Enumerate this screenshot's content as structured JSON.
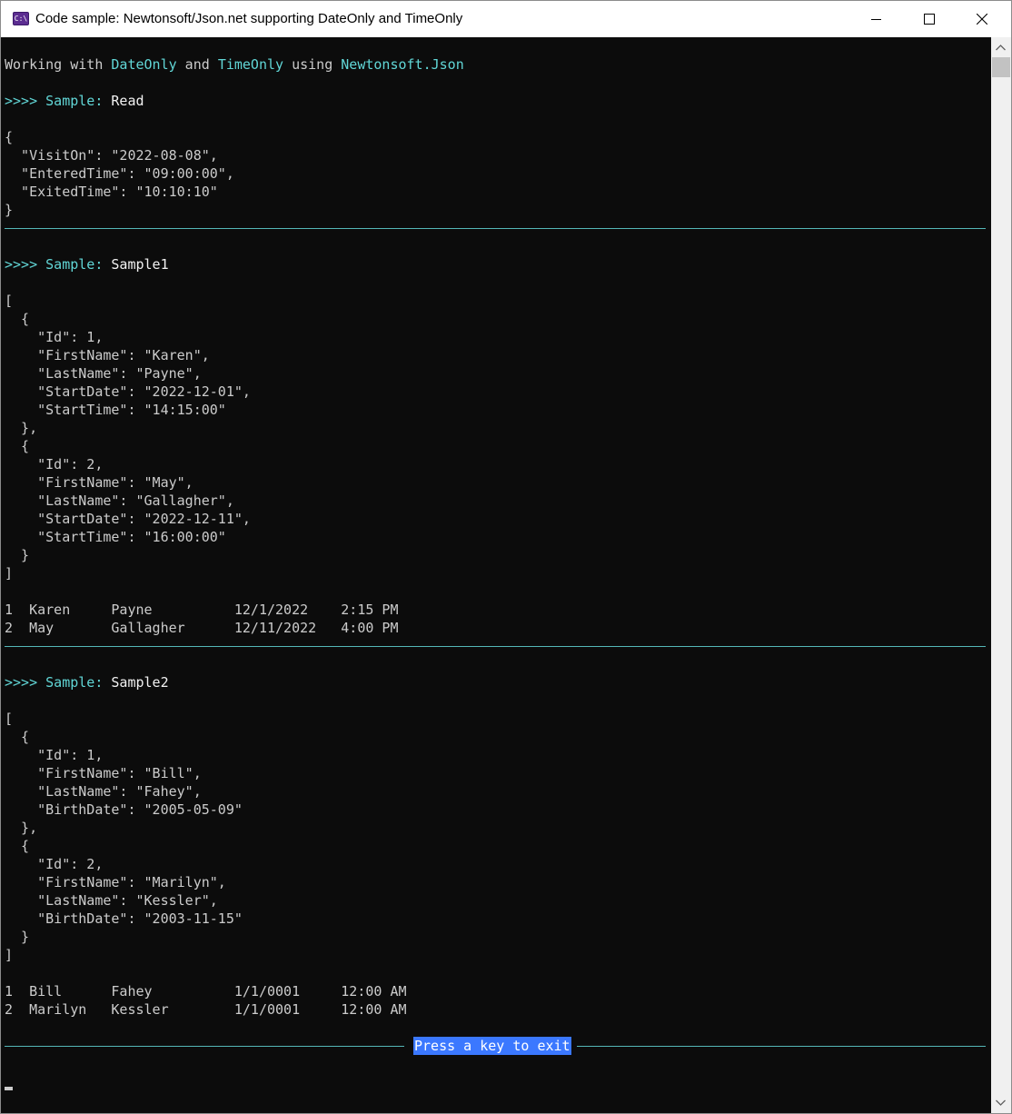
{
  "window": {
    "title": "Code sample: Newtonsoft/Json.net supporting DateOnly and TimeOnly",
    "icon": "console-app-icon",
    "icon_text": "C:\\"
  },
  "colors": {
    "background": "#0c0c0c",
    "text": "#cccccc",
    "accent": "#61d6d6",
    "highlight": "#3b78ff"
  },
  "header": {
    "p1": "Working with ",
    "dateonly": "DateOnly",
    "p2": " and ",
    "timeonly": "TimeOnly",
    "p3": " using ",
    "lib": "Newtonsoft.Json"
  },
  "prompt_marker": ">>>> Sample: ",
  "samples": {
    "read": {
      "name": "Read",
      "lines": [
        "{",
        "  \"VisitOn\": \"2022-08-08\",",
        "  \"EnteredTime\": \"09:00:00\",",
        "  \"ExitedTime\": \"10:10:10\"",
        "}"
      ]
    },
    "sample1": {
      "name": "Sample1",
      "lines": [
        "[",
        "  {",
        "    \"Id\": 1,",
        "    \"FirstName\": \"Karen\",",
        "    \"LastName\": \"Payne\",",
        "    \"StartDate\": \"2022-12-01\",",
        "    \"StartTime\": \"14:15:00\"",
        "  },",
        "  {",
        "    \"Id\": 2,",
        "    \"FirstName\": \"May\",",
        "    \"LastName\": \"Gallagher\",",
        "    \"StartDate\": \"2022-12-11\",",
        "    \"StartTime\": \"16:00:00\"",
        "  }",
        "]"
      ],
      "rows": [
        "1  Karen     Payne          12/1/2022    2:15 PM",
        "2  May       Gallagher      12/11/2022   4:00 PM"
      ]
    },
    "sample2": {
      "name": "Sample2",
      "lines": [
        "[",
        "  {",
        "    \"Id\": 1,",
        "    \"FirstName\": \"Bill\",",
        "    \"LastName\": \"Fahey\",",
        "    \"BirthDate\": \"2005-05-09\"",
        "  },",
        "  {",
        "    \"Id\": 2,",
        "    \"FirstName\": \"Marilyn\",",
        "    \"LastName\": \"Kessler\",",
        "    \"BirthDate\": \"2003-11-15\"",
        "  }",
        "]"
      ],
      "rows": [
        "1  Bill      Fahey          1/1/0001     12:00 AM",
        "2  Marilyn   Kessler        1/1/0001     12:00 AM"
      ]
    }
  },
  "footer": {
    "press_key": "Press a key to exit"
  }
}
